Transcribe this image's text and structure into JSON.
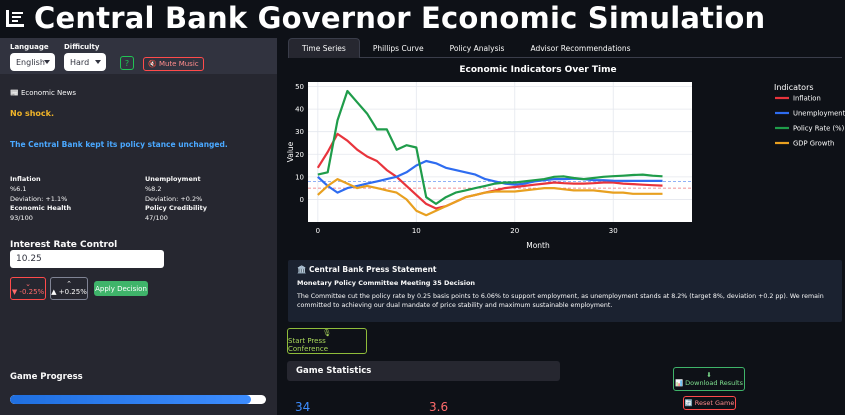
{
  "app": {
    "title": "Central Bank Governor Economic Simulation"
  },
  "sidebar": {
    "language_label": "Language",
    "language_value": "English",
    "difficulty_label": "Difficulty",
    "difficulty_value": "Hard",
    "help_glyph": "?",
    "mute_label": "🔇 Mute Music",
    "news_title": "📰 Economic News",
    "shock_text": "No shock.",
    "stance_text": "The Central Bank kept its policy stance unchanged.",
    "metrics": {
      "inflation_label": "Inflation",
      "inflation_value": "%6.1",
      "inflation_dev": "Deviation: +1.1%",
      "unemployment_label": "Unemployment",
      "unemployment_value": "%8.2",
      "unemployment_dev": "Deviation: +0.2%",
      "health_label": "Economic Health",
      "health_value": "93/100",
      "credibility_label": "Policy Credibility",
      "credibility_value": "47/100"
    },
    "rate_control_title": "Interest Rate Control",
    "rate_value": "10.25",
    "decrease_label": "▼ -0.25%",
    "increase_label": "▲ +0.25%",
    "apply_label": "Apply Decision",
    "progress_label": "Game Progress",
    "progress_fraction": 0.94
  },
  "tabs": [
    {
      "label": "Time Series"
    },
    {
      "label": "Phillips Curve"
    },
    {
      "label": "Policy Analysis"
    },
    {
      "label": "Advisor Recommendations"
    }
  ],
  "chart_data": {
    "type": "line",
    "title": "Economic Indicators Over Time",
    "xlabel": "Month",
    "ylabel": "Value",
    "xlim": [
      -1,
      38
    ],
    "ylim": [
      -10,
      52
    ],
    "xticks": [
      0,
      10,
      20,
      30
    ],
    "yticks": [
      0,
      10,
      20,
      30,
      40,
      50
    ],
    "legend_title": "Indicators",
    "legend_position": "right",
    "x": [
      0,
      1,
      2,
      3,
      4,
      5,
      6,
      7,
      8,
      9,
      10,
      11,
      12,
      13,
      14,
      15,
      16,
      17,
      18,
      19,
      20,
      21,
      22,
      23,
      24,
      25,
      26,
      27,
      28,
      29,
      30,
      31,
      32,
      33,
      34,
      35
    ],
    "series": [
      {
        "name": "Inflation",
        "color": "#e8343c",
        "values": [
          14,
          21,
          29,
          26,
          22,
          19,
          17,
          13,
          10,
          6,
          2,
          -2,
          -4,
          -3,
          -1,
          1,
          2,
          3,
          4,
          5,
          5.5,
          6,
          6.5,
          7,
          7.5,
          7.2,
          7,
          7,
          7.2,
          7.5,
          7.5,
          7,
          6.8,
          6.5,
          6.3,
          6.1
        ]
      },
      {
        "name": "Unemployment",
        "color": "#2e6cf0",
        "values": [
          10,
          6,
          3,
          5,
          6,
          7,
          8,
          9,
          10,
          12,
          15,
          17,
          16,
          14,
          13,
          12,
          11,
          9,
          8,
          7,
          6.5,
          7,
          8,
          8.5,
          9,
          9,
          9.2,
          9,
          8.5,
          8.5,
          8.3,
          8.2,
          8.2,
          8.2,
          8.2,
          8.2
        ]
      },
      {
        "name": "Policy Rate (%)",
        "color": "#1f9c4a",
        "values": [
          11,
          12,
          35,
          48,
          43,
          38,
          31,
          31,
          22,
          24,
          23,
          1,
          -2,
          1,
          3,
          4,
          5,
          6,
          7,
          7.5,
          7.5,
          8,
          8.5,
          9,
          10,
          10.2,
          9.5,
          9,
          9.5,
          10,
          10.3,
          10.5,
          10.8,
          11,
          10.5,
          10.25
        ]
      },
      {
        "name": "GDP Growth",
        "color": "#e8a020",
        "values": [
          2,
          6,
          9,
          7,
          5,
          6,
          5,
          4,
          3,
          0,
          -5,
          -7,
          -5,
          -3,
          -1,
          1,
          2,
          3,
          3.5,
          3.5,
          3.5,
          4,
          4.5,
          5,
          5,
          4.5,
          4,
          4,
          4,
          3.5,
          3,
          3,
          2.5,
          2.5,
          2.5,
          2.5
        ]
      }
    ],
    "reference_lines": [
      {
        "value": 8,
        "color": "#2e6cf0"
      },
      {
        "value": 5,
        "color": "#e8343c"
      }
    ]
  },
  "press": {
    "heading": "🏛️ Central Bank Press Statement",
    "subheading": "Monetary Policy Committee Meeting 35 Decision",
    "body": "The Committee cut the policy rate by 0.25 basis points to 6.06% to support employment, as unemployment stands at 8.2% (target 8%, deviation +0.2 pp). We remain committed to achieving our dual mandate of price stability and maximum sustainable employment."
  },
  "actions": {
    "conference_icon": "🎙",
    "conference_label": "Start Press Conference",
    "download_icon": "⬇",
    "download_label": "📊 Download Results",
    "reset_label": "🔄 Reset Game"
  },
  "stats": {
    "title": "Game Statistics",
    "value1": "34",
    "value2": "3.6"
  },
  "colors": {
    "background": "#0e1117",
    "sidebar": "#262730",
    "accent_green": "#3fb46a",
    "accent_red": "#ff4b4b",
    "accent_blue": "#3d8dff"
  }
}
